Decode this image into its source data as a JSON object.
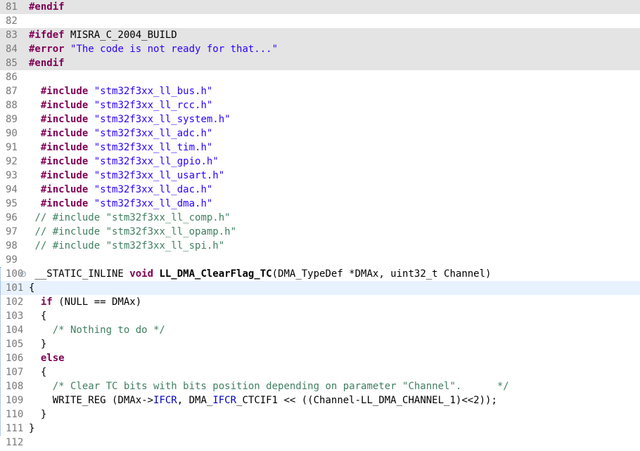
{
  "lines": [
    {
      "n": "81",
      "t": "#endif"
    },
    {
      "n": "82",
      "t": ""
    },
    {
      "n": "83",
      "t": "#ifdef MISRA_C_2004_BUILD"
    },
    {
      "n": "84",
      "t": "#error \"The code is not ready for that...\""
    },
    {
      "n": "85",
      "t": "#endif"
    },
    {
      "n": "86",
      "t": ""
    },
    {
      "n": "87",
      "t": "  #include \"stm32f3xx_ll_bus.h\""
    },
    {
      "n": "88",
      "t": "  #include \"stm32f3xx_ll_rcc.h\""
    },
    {
      "n": "89",
      "t": "  #include \"stm32f3xx_ll_system.h\""
    },
    {
      "n": "90",
      "t": "  #include \"stm32f3xx_ll_adc.h\""
    },
    {
      "n": "91",
      "t": "  #include \"stm32f3xx_ll_tim.h\""
    },
    {
      "n": "92",
      "t": "  #include \"stm32f3xx_ll_gpio.h\""
    },
    {
      "n": "93",
      "t": "  #include \"stm32f3xx_ll_usart.h\""
    },
    {
      "n": "94",
      "t": "  #include \"stm32f3xx_ll_dac.h\""
    },
    {
      "n": "95",
      "t": "  #include \"stm32f3xx_ll_dma.h\""
    },
    {
      "n": "96",
      "t": " // #include \"stm32f3xx_ll_comp.h\""
    },
    {
      "n": "97",
      "t": " // #include \"stm32f3xx_ll_opamp.h\""
    },
    {
      "n": "98",
      "t": " // #include \"stm32f3xx_ll_spi.h\""
    },
    {
      "n": "99",
      "t": ""
    },
    {
      "n": "100",
      "t": " __STATIC_INLINE void LL_DMA_ClearFlag_TC(DMA_TypeDef *DMAx, uint32_t Channel)"
    },
    {
      "n": "101",
      "t": "{"
    },
    {
      "n": "102",
      "t": "  if (NULL == DMAx)"
    },
    {
      "n": "103",
      "t": "  {"
    },
    {
      "n": "104",
      "t": "    /* Nothing to do */"
    },
    {
      "n": "105",
      "t": "  }"
    },
    {
      "n": "106",
      "t": "  else"
    },
    {
      "n": "107",
      "t": "  {"
    },
    {
      "n": "108",
      "t": "    /* Clear TC bits with bits position depending on parameter \"Channel\".      */"
    },
    {
      "n": "109",
      "t": "    WRITE_REG (DMAx->IFCR, DMA_IFCR_CTCIF1 << ((Channel-LL_DMA_CHANNEL_1)<<2));"
    },
    {
      "n": "110",
      "t": "  }"
    },
    {
      "n": "111",
      "t": "}"
    },
    {
      "n": "112",
      "t": ""
    }
  ],
  "colors": {
    "keyword": "#7f0055",
    "string": "#2a00ff",
    "comment": "#3f7f5f",
    "inactive_block": "#e4e4e4",
    "current_line": "#e8f2fe"
  },
  "icons": {
    "fold": "fold-collapse-icon"
  }
}
